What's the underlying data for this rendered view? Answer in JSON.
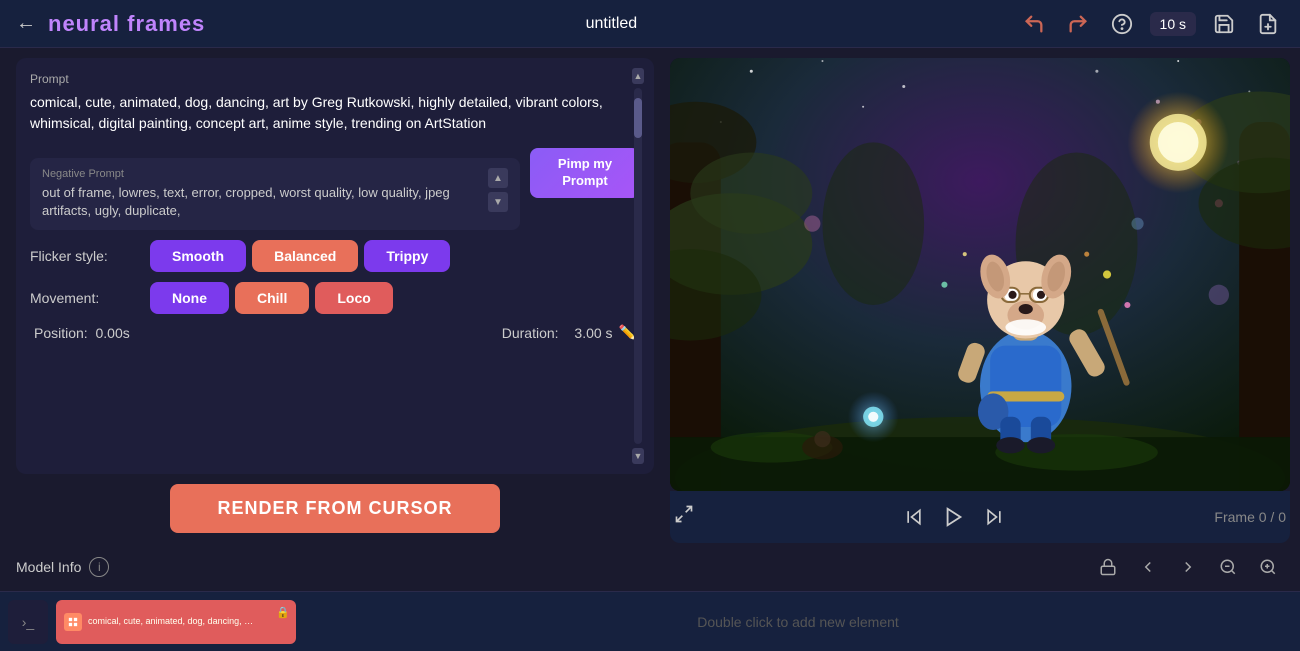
{
  "app": {
    "logo": "neural frames",
    "title": "untitled",
    "duration_label": "10 s"
  },
  "topbar": {
    "back_icon": "←",
    "undo_icon": "↺",
    "redo_icon": "↻",
    "help_icon": "?",
    "save_icon": "💾",
    "export_icon": "📤"
  },
  "prompt": {
    "label": "Prompt",
    "text": "comical, cute, animated, dog, dancing, art by Greg Rutkowski, highly detailed, vibrant colors, whimsical, digital painting, concept art, anime style, trending on ArtStation"
  },
  "negative_prompt": {
    "label": "Negative Prompt",
    "text": "out of frame, lowres, text, error, cropped, worst quality, low quality, jpeg artifacts, ugly, duplicate,"
  },
  "pimp_btn": {
    "line1": "Pimp my",
    "line2": "Prompt"
  },
  "flicker": {
    "label": "Flicker style:",
    "smooth": "Smooth",
    "balanced": "Balanced",
    "trippy": "Trippy"
  },
  "movement": {
    "label": "Movement:",
    "none": "None",
    "chill": "Chill",
    "loco": "Loco"
  },
  "position": {
    "label": "Position:",
    "value": "0.00s"
  },
  "duration": {
    "label": "Duration:",
    "value": "3.00 s"
  },
  "render_btn": "RENDER FROM CURSOR",
  "model_info": {
    "label": "Model Info"
  },
  "preview": {
    "frame_label": "Frame 0 / 0"
  },
  "timeline": {
    "add_hint": "Double click to add new element",
    "element_text": "comical, cute, animated, dog, dancing, art by Greg Rutkowski, highly detailed, vibrant colors, whimsical, concept"
  }
}
